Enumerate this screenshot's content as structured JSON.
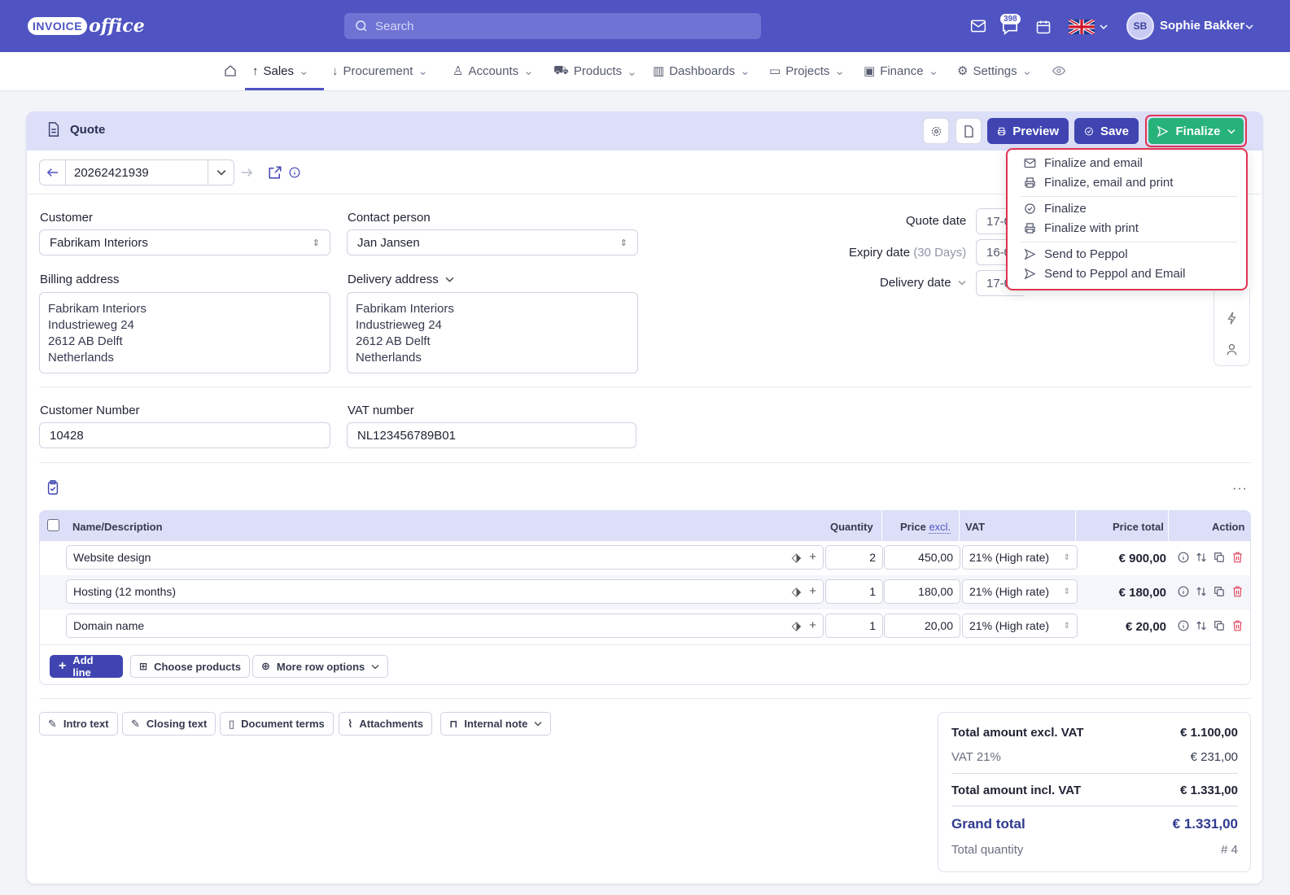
{
  "brand": {
    "pill": "INVOICE",
    "script": "office"
  },
  "search": {
    "placeholder": "Search"
  },
  "header": {
    "notifications_count": "398",
    "user_initials": "SB",
    "user_name": "Sophie Bakker"
  },
  "nav": {
    "items": [
      {
        "label": "Sales"
      },
      {
        "label": "Procurement"
      },
      {
        "label": "Accounts"
      },
      {
        "label": "Products"
      },
      {
        "label": "Dashboards"
      },
      {
        "label": "Projects"
      },
      {
        "label": "Finance"
      },
      {
        "label": "Settings"
      }
    ]
  },
  "toolbar": {
    "title": "Quote",
    "preview_label": "Preview",
    "save_label": "Save",
    "finalize_label": "Finalize"
  },
  "finalize_menu": {
    "items": [
      {
        "label": "Finalize and email",
        "icon": "mail-icon"
      },
      {
        "label": "Finalize, email and print",
        "icon": "printer-icon"
      },
      {
        "label": "Finalize",
        "icon": "check-circle-icon"
      },
      {
        "label": "Finalize with print",
        "icon": "printer-icon"
      },
      {
        "label": "Send to Peppol",
        "icon": "send-icon"
      },
      {
        "label": "Send to Peppol and Email",
        "icon": "send-icon"
      }
    ]
  },
  "document": {
    "number": "20262421939"
  },
  "customer": {
    "label": "Customer",
    "value": "Fabrikam Interiors"
  },
  "contact": {
    "label": "Contact person",
    "value": "Jan Jansen"
  },
  "billing": {
    "label": "Billing address",
    "lines": [
      "Fabrikam Interiors",
      "Industrieweg 24",
      "2612 AB Delft",
      "Netherlands"
    ]
  },
  "delivery": {
    "label": "Delivery address",
    "lines": [
      "Fabrikam Interiors",
      "Industrieweg 24",
      "2612 AB Delft",
      "Netherlands"
    ]
  },
  "dates": {
    "quote_label": "Quote date",
    "quote_value": "17-0",
    "expiry_label": "Expiry date",
    "expiry_hint": "(30 Days)",
    "expiry_value": "16-0",
    "delivery_label": "Delivery date",
    "delivery_value": "17-0"
  },
  "customer_number": {
    "label": "Customer Number",
    "value": "10428"
  },
  "vat_number": {
    "label": "VAT number",
    "value": "NL123456789B01"
  },
  "table": {
    "headers": {
      "name": "Name/Description",
      "quantity": "Quantity",
      "price": "Price",
      "price_suffix": "excl.",
      "vat": "VAT",
      "total": "Price total",
      "action": "Action"
    },
    "rows": [
      {
        "name": "Website design",
        "qty": "2",
        "price": "450,00",
        "vat": "21% (High rate)",
        "total": "€ 900,00"
      },
      {
        "name": "Hosting (12 months)",
        "qty": "1",
        "price": "180,00",
        "vat": "21% (High rate)",
        "total": "€ 180,00"
      },
      {
        "name": "Domain name",
        "qty": "1",
        "price": "20,00",
        "vat": "21% (High rate)",
        "total": "€ 20,00"
      }
    ],
    "add_line": "Add line",
    "choose_products": "Choose products",
    "more_row_options": "More row options"
  },
  "bottom_tabs": {
    "intro": "Intro text",
    "closing": "Closing text",
    "terms": "Document terms",
    "attachments": "Attachments",
    "note": "Internal note"
  },
  "totals": {
    "excl_label": "Total amount excl. VAT",
    "excl_value": "€ 1.100,00",
    "vat_label": "VAT 21%",
    "vat_value": "€ 231,00",
    "incl_label": "Total amount incl. VAT",
    "incl_value": "€ 1.331,00",
    "grand_label": "Grand total",
    "grand_value": "€ 1.331,00",
    "qty_label": "Total quantity",
    "qty_value": "# 4"
  },
  "colors": {
    "topbar": "#4f54c2",
    "primary": "#3f44b1",
    "finalize": "#27b27a",
    "highlight": "#e03450",
    "table_head": "#dcdff7"
  }
}
